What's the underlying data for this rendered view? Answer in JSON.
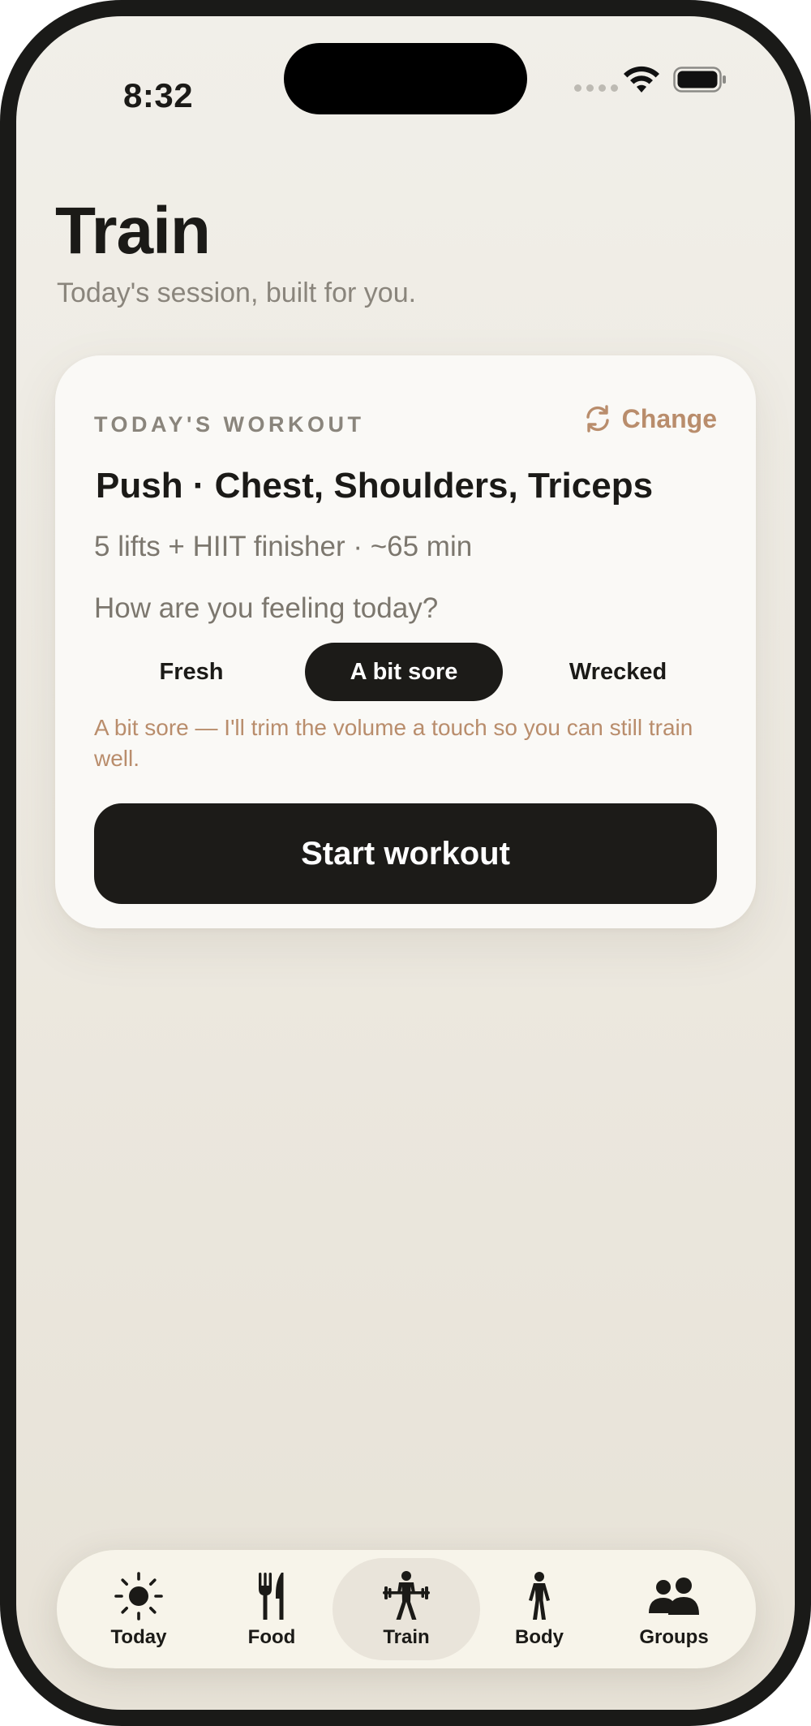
{
  "status_bar": {
    "time": "8:32",
    "icons": [
      "cellular-signal-icon",
      "wifi-icon",
      "battery-icon"
    ]
  },
  "header": {
    "title": "Train",
    "subtitle": "Today's session, built for you."
  },
  "workout_card": {
    "label": "TODAY'S WORKOUT",
    "change_label": "Change",
    "change_icon": "refresh-icon",
    "title": "Push · Chest, Shoulders, Triceps",
    "meta": "5 lifts + HIIT finisher · ~65 min",
    "feeling_question": "How are you feeling today?",
    "mood_options": [
      {
        "label": "Fresh",
        "selected": false
      },
      {
        "label": "A bit sore",
        "selected": true
      },
      {
        "label": "Wrecked",
        "selected": false
      }
    ],
    "mood_note": "A bit sore — I'll trim the volume a touch so you can still train well.",
    "start_label": "Start workout"
  },
  "tab_bar": {
    "active": "Train",
    "items": [
      {
        "label": "Today",
        "icon": "sun-icon"
      },
      {
        "label": "Food",
        "icon": "fork-knife-icon"
      },
      {
        "label": "Train",
        "icon": "weightlifter-icon"
      },
      {
        "label": "Body",
        "icon": "person-icon"
      },
      {
        "label": "Groups",
        "icon": "group-icon"
      }
    ]
  },
  "colors": {
    "background": "#efece5",
    "card": "#faf9f6",
    "text_primary": "#1b1a17",
    "text_secondary": "#7c776e",
    "accent": "#b98d6c",
    "dark_button": "#1c1b18",
    "tab_bar": "#f7f4ea"
  }
}
